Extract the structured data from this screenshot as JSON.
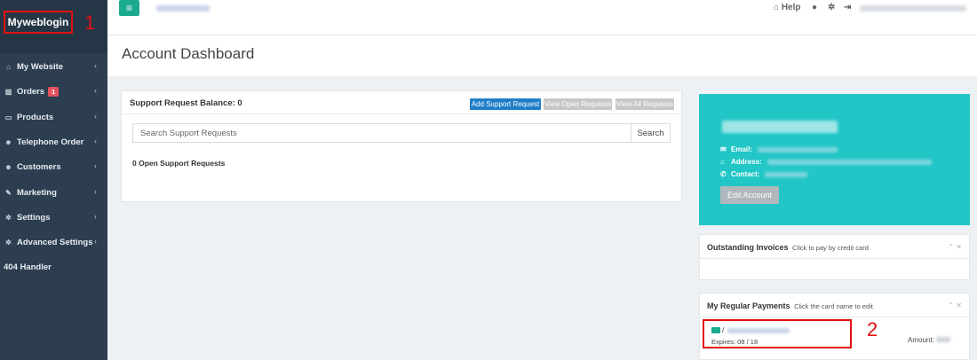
{
  "brand": {
    "name": "Myweblogin",
    "marker": "1"
  },
  "sidebar": {
    "items": [
      {
        "icon": "home-icon",
        "glyph": "⌂",
        "label": "My Website",
        "chevron": "‹"
      },
      {
        "icon": "bar-chart-icon",
        "glyph": "▥",
        "label": "Orders",
        "badge": "1",
        "chevron": "‹"
      },
      {
        "icon": "monitor-icon",
        "glyph": "▭",
        "label": "Products",
        "chevron": "‹"
      },
      {
        "icon": "users-icon",
        "glyph": "☻",
        "label": "Telephone Order",
        "chevron": "‹"
      },
      {
        "icon": "users-icon",
        "glyph": "☻",
        "label": "Customers",
        "chevron": "‹"
      },
      {
        "icon": "wrench-icon",
        "glyph": "✎",
        "label": "Marketing",
        "chevron": "‹"
      },
      {
        "icon": "gear-icon",
        "glyph": "✲",
        "label": "Settings",
        "chevron": "‹"
      },
      {
        "icon": "gears-icon",
        "glyph": "✲",
        "label": "Advanced Settings",
        "chevron": "‹"
      },
      {
        "icon": "",
        "glyph": "",
        "label": "404 Handler",
        "chevron": ""
      }
    ]
  },
  "topbar": {
    "menu_glyph": "≡",
    "help_label": "Help",
    "help_glyph": "⌂",
    "user_glyph": "●",
    "settings_glyph": "✲",
    "logout_glyph": "⇥"
  },
  "page": {
    "title": "Account Dashboard"
  },
  "support": {
    "balance_label": "Support Request Balance: 0",
    "add_label": "Add Support Request",
    "view_open_label": "View Open Requests",
    "view_all_label": "View All Requests",
    "search_placeholder": "Search Support Requests",
    "search_button": "Search",
    "open_count": "0 Open Support Requests"
  },
  "profile": {
    "email_label": "Email:",
    "address_label": "Address:",
    "contact_label": "Contact:",
    "edit_button": "Edit Account"
  },
  "invoices": {
    "title": "Outstanding Invoices",
    "hint": "Click to pay by credit card",
    "ctrl": "⌃ ✕"
  },
  "payments": {
    "title": "My Regular Payments",
    "hint": "Click the card name to edit",
    "ctrl": "⌃ ✕",
    "card_slash": "/",
    "expires": "Expires: 08 / 18",
    "amount_label": "Amount: ",
    "marker": "2"
  },
  "colors": {
    "sidebar_bg": "#2c3e50",
    "accent_teal": "#1aaa8c",
    "profile_bg": "#22c6c6",
    "primary_blue": "#1f7ec7",
    "annotation_red": "#e31010",
    "badge_red": "#e5525f"
  }
}
